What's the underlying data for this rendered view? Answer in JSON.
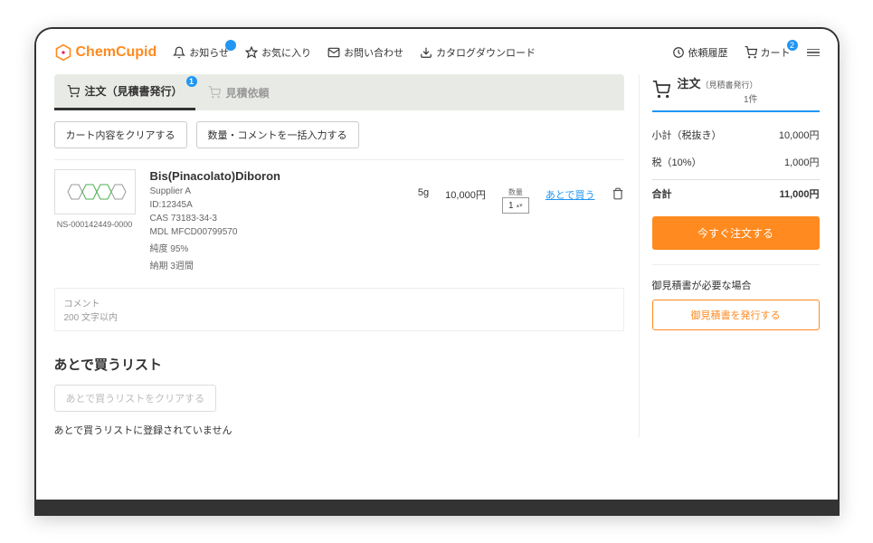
{
  "logo": "ChemCupid",
  "nav": {
    "news": "お知らせ",
    "fav": "お気に入り",
    "contact": "お問い合わせ",
    "catalog": "カタログダウンロード",
    "history": "依頼履歴",
    "cart": "カート",
    "cart_badge": "2"
  },
  "tabs": {
    "order": "注文（見積書発行）",
    "order_badge": "1",
    "quote": "見積依頼"
  },
  "actions": {
    "clear_cart": "カート内容をクリアする",
    "bulk_input": "数量・コメントを一括入力する"
  },
  "product": {
    "sku": "NS-000142449-0000",
    "name": "Bis(Pinacolato)Diboron",
    "supplier": "Supplier A",
    "id_label": "ID:12345A",
    "cas": "CAS 73183-34-3",
    "mdl": "MDL MFCD00799570",
    "purity": "純度 95%",
    "leadtime": "納期 3週間",
    "size": "5g",
    "price": "10,000円",
    "qty_label": "数量",
    "qty": "1",
    "later": "あとで買う"
  },
  "comment": {
    "label": "コメント",
    "limit": "200 文字以内"
  },
  "later_section": {
    "title": "あとで買うリスト",
    "clear": "あとで買うリストをクリアする",
    "empty": "あとで買うリストに登録されていません"
  },
  "summary": {
    "title": "注文",
    "sub": "（見積書発行）",
    "count": "1件",
    "subtotal_label": "小計（税抜き）",
    "subtotal": "10,000円",
    "tax_label": "税（10%）",
    "tax": "1,000円",
    "total_label": "合計",
    "total": "11,000円",
    "order_now": "今すぐ注文する",
    "quote_note": "御見積書が必要な場合",
    "issue_quote": "御見積書を発行する"
  }
}
